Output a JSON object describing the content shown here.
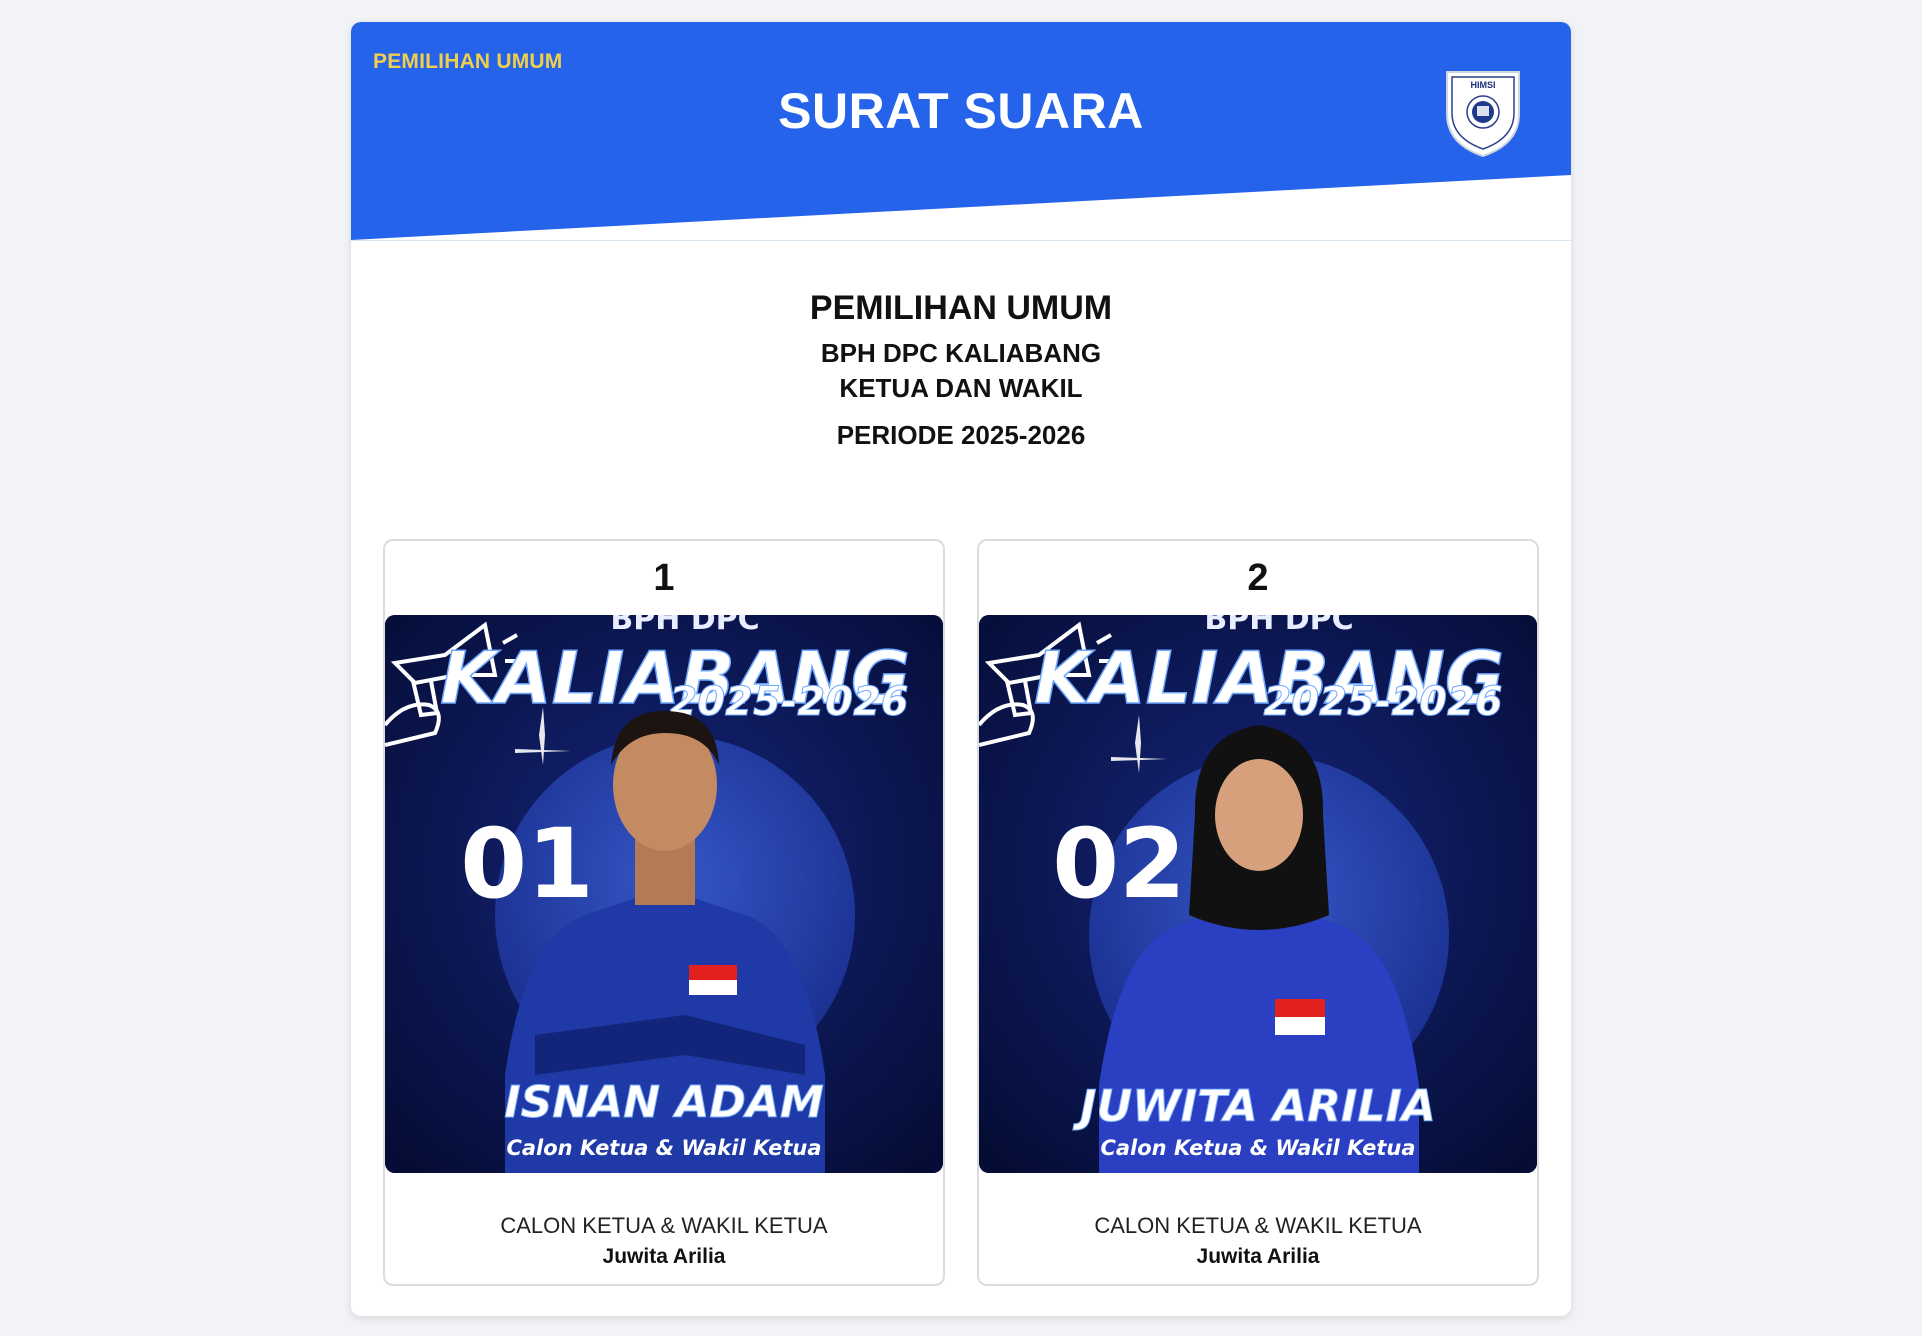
{
  "header": {
    "kicker": "PEMILIHAN UMUM",
    "title": "SURAT SUARA",
    "logo_text": "HIMSI",
    "color_primary": "#2563eb",
    "color_kicker": "#f2cf4a"
  },
  "intro": {
    "title": "PEMILIHAN UMUM",
    "line1": "BPH DPC KALIABANG",
    "line2": "KETUA DAN WAKIL",
    "period": "PERIODE 2025-2026"
  },
  "candidates": [
    {
      "number": "1",
      "poster": {
        "heading_partial": "BPH DPC",
        "heading": "KALIABANG",
        "years": "2025-2026",
        "big_number": "01",
        "name": "ISNAN ADAM",
        "caption": "Calon Ketua & Wakil Ketua"
      },
      "role": "CALON KETUA & WAKIL KETUA",
      "name": "Juwita Arilia"
    },
    {
      "number": "2",
      "poster": {
        "heading_partial": "BPH DPC",
        "heading": "KALIABANG",
        "years": "2025-2026",
        "big_number": "02",
        "name": "JUWITA ARILIA",
        "caption": "Calon Ketua & Wakil Ketua"
      },
      "role": "CALON KETUA & WAKIL KETUA",
      "name": "Juwita Arilia"
    }
  ]
}
